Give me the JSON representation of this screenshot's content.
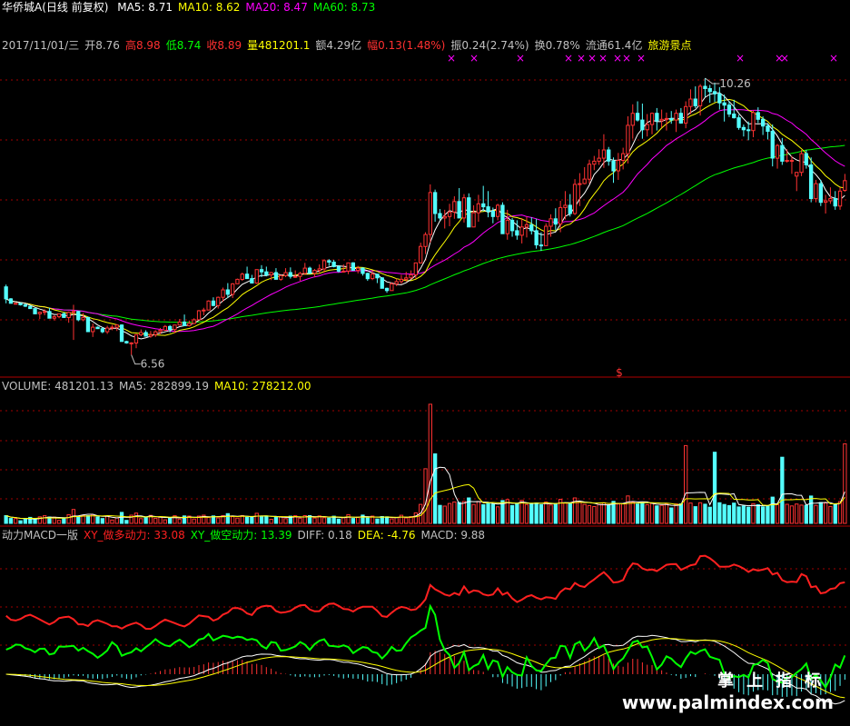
{
  "header": {
    "title": "华侨城A(日线 前复权)",
    "ma": [
      {
        "label": "MA5: 8.71",
        "color": "#ffffff"
      },
      {
        "label": "MA10: 8.62",
        "color": "#ffff00"
      },
      {
        "label": "MA20: 8.47",
        "color": "#ff00ff"
      },
      {
        "label": "MA60: 8.73",
        "color": "#00ff00"
      }
    ]
  },
  "quote": [
    {
      "text": "2017/11/01/三",
      "color": "#c0c0c0"
    },
    {
      "text": "开8.76",
      "color": "#c0c0c0"
    },
    {
      "text": "高8.98",
      "color": "#ff3030"
    },
    {
      "text": "低8.74",
      "color": "#00ff00"
    },
    {
      "text": "收8.89",
      "color": "#ff3030"
    },
    {
      "text": "量481201.1",
      "color": "#ffff00"
    },
    {
      "text": "额4.29亿",
      "color": "#c0c0c0"
    },
    {
      "text": "幅0.13(1.48%)",
      "color": "#ff3030"
    },
    {
      "text": "振0.24(2.74%)",
      "color": "#c0c0c0"
    },
    {
      "text": "换0.78%",
      "color": "#c0c0c0"
    },
    {
      "text": "流通61.4亿",
      "color": "#c0c0c0"
    },
    {
      "text": "旅游景点",
      "color": "#ffff00"
    }
  ],
  "volume_header": [
    {
      "text": "VOLUME: 481201.13",
      "color": "#c0c0c0"
    },
    {
      "text": "MA5: 282899.19",
      "color": "#c0c0c0"
    },
    {
      "text": "MA10: 278212.00",
      "color": "#ffff00"
    }
  ],
  "macd_header": [
    {
      "text": "动力MACD一版",
      "color": "#c0c0c0"
    },
    {
      "text": "XY_做多动力: 33.08",
      "color": "#ff2020"
    },
    {
      "text": "XY_做空动力: 13.39",
      "color": "#00ff00"
    },
    {
      "text": "DIFF: 0.18",
      "color": "#c0c0c0"
    },
    {
      "text": "DEA: -4.76",
      "color": "#ffff00"
    },
    {
      "text": "MACD: 9.88",
      "color": "#c0c0c0"
    }
  ],
  "annotations": {
    "high": "10.26",
    "low": "6.56",
    "marker": "$"
  },
  "watermark": {
    "cn": "掌上指标",
    "url": "www.palmindex.com"
  },
  "colors": {
    "up": "#ff3232",
    "down": "#54ffff",
    "ma5": "#ffffff",
    "ma10": "#ffff00",
    "ma20": "#ff00ff",
    "ma60": "#00ff00",
    "grid": "#a00000",
    "force_long": "#ff2020",
    "force_short": "#00ff00"
  },
  "chart_data": {
    "type": "candlestick",
    "ylim": [
      6.3,
      10.6
    ],
    "ohlc": [
      [
        7.47,
        7.5,
        7.25,
        7.31
      ],
      [
        7.31,
        7.32,
        7.25,
        7.25
      ],
      [
        7.25,
        7.25,
        7.25,
        7.25
      ],
      [
        7.25,
        7.25,
        7.22,
        7.23
      ],
      [
        7.23,
        7.24,
        7.2,
        7.21
      ],
      [
        7.21,
        7.21,
        7.18,
        7.18
      ],
      [
        7.18,
        7.18,
        7.11,
        7.11
      ],
      [
        7.11,
        7.14,
        7.04,
        7.13
      ],
      [
        7.13,
        7.17,
        7.09,
        7.14
      ],
      [
        7.14,
        7.19,
        7.05,
        7.05
      ],
      [
        7.05,
        7.09,
        7.02,
        7.07
      ],
      [
        7.07,
        7.11,
        7.05,
        7.11
      ],
      [
        7.11,
        7.13,
        7.06,
        7.06
      ],
      [
        7.06,
        7.14,
        6.99,
        7.13
      ],
      [
        7.13,
        7.23,
        6.76,
        7.14
      ],
      [
        7.14,
        7.15,
        7.01,
        7.03
      ],
      [
        7.03,
        7.12,
        7.01,
        7.06
      ],
      [
        7.06,
        7.07,
        6.87,
        6.87
      ],
      [
        6.87,
        6.98,
        6.8,
        6.93
      ],
      [
        6.93,
        6.94,
        6.91,
        6.91
      ],
      [
        6.91,
        6.93,
        6.85,
        6.87
      ],
      [
        6.87,
        6.95,
        6.84,
        6.92
      ],
      [
        6.92,
        6.96,
        6.89,
        6.93
      ],
      [
        6.93,
        6.97,
        6.88,
        6.96
      ],
      [
        6.96,
        6.97,
        6.74,
        6.74
      ],
      [
        6.74,
        6.75,
        6.71,
        6.72
      ],
      [
        6.72,
        6.73,
        6.56,
        6.72
      ],
      [
        6.72,
        6.84,
        6.65,
        6.83
      ],
      [
        6.83,
        6.9,
        6.81,
        6.86
      ],
      [
        6.86,
        6.89,
        6.81,
        6.81
      ],
      [
        6.81,
        6.88,
        6.79,
        6.83
      ],
      [
        6.83,
        6.89,
        6.8,
        6.87
      ],
      [
        6.87,
        6.92,
        6.84,
        6.89
      ],
      [
        6.89,
        6.96,
        6.88,
        6.94
      ],
      [
        6.94,
        6.96,
        6.86,
        6.9
      ],
      [
        6.9,
        6.96,
        6.85,
        6.96
      ],
      [
        6.96,
        7.04,
        6.95,
        7.0
      ],
      [
        7.0,
        7.1,
        6.95,
        6.95
      ],
      [
        6.95,
        7.02,
        6.94,
        6.98
      ],
      [
        6.98,
        7.05,
        6.97,
        7.03
      ],
      [
        7.03,
        7.16,
        7.03,
        7.15
      ],
      [
        7.15,
        7.19,
        7.09,
        7.16
      ],
      [
        7.16,
        7.29,
        7.16,
        7.28
      ],
      [
        7.28,
        7.33,
        7.21,
        7.22
      ],
      [
        7.22,
        7.34,
        7.18,
        7.33
      ],
      [
        7.33,
        7.46,
        7.27,
        7.43
      ],
      [
        7.43,
        7.52,
        7.32,
        7.37
      ],
      [
        7.37,
        7.52,
        7.32,
        7.51
      ],
      [
        7.51,
        7.58,
        7.51,
        7.57
      ],
      [
        7.57,
        7.66,
        7.55,
        7.64
      ],
      [
        7.64,
        7.74,
        7.58,
        7.58
      ],
      [
        7.58,
        7.63,
        7.52,
        7.52
      ],
      [
        7.52,
        7.7,
        7.51,
        7.7
      ],
      [
        7.7,
        7.76,
        7.6,
        7.67
      ],
      [
        7.67,
        7.74,
        7.61,
        7.63
      ],
      [
        7.63,
        7.67,
        7.56,
        7.66
      ],
      [
        7.66,
        7.72,
        7.57,
        7.57
      ],
      [
        7.57,
        7.63,
        7.55,
        7.62
      ],
      [
        7.62,
        7.72,
        7.6,
        7.66
      ],
      [
        7.66,
        7.73,
        7.58,
        7.61
      ],
      [
        7.61,
        7.69,
        7.59,
        7.61
      ],
      [
        7.61,
        7.67,
        7.55,
        7.65
      ],
      [
        7.65,
        7.79,
        7.63,
        7.72
      ],
      [
        7.72,
        7.74,
        7.65,
        7.65
      ],
      [
        7.65,
        7.71,
        7.6,
        7.69
      ],
      [
        7.69,
        7.77,
        7.64,
        7.71
      ],
      [
        7.71,
        7.84,
        7.66,
        7.82
      ],
      [
        7.82,
        7.84,
        7.75,
        7.8
      ],
      [
        7.8,
        7.83,
        7.73,
        7.74
      ],
      [
        7.74,
        7.76,
        7.66,
        7.68
      ],
      [
        7.68,
        7.77,
        7.67,
        7.68
      ],
      [
        7.68,
        7.79,
        7.64,
        7.79
      ],
      [
        7.79,
        7.8,
        7.69,
        7.69
      ],
      [
        7.69,
        7.75,
        7.65,
        7.72
      ],
      [
        7.72,
        7.73,
        7.62,
        7.65
      ],
      [
        7.65,
        7.66,
        7.55,
        7.58
      ],
      [
        7.58,
        7.68,
        7.56,
        7.64
      ],
      [
        7.64,
        7.64,
        7.52,
        7.59
      ],
      [
        7.59,
        7.6,
        7.45,
        7.45
      ],
      [
        7.45,
        7.46,
        7.39,
        7.42
      ],
      [
        7.42,
        7.53,
        7.42,
        7.51
      ],
      [
        7.51,
        7.58,
        7.48,
        7.54
      ],
      [
        7.54,
        7.63,
        7.51,
        7.57
      ],
      [
        7.57,
        7.67,
        7.54,
        7.59
      ],
      [
        7.59,
        7.69,
        7.57,
        7.63
      ],
      [
        7.63,
        7.79,
        7.58,
        7.79
      ],
      [
        7.79,
        8.06,
        7.78,
        8.01
      ],
      [
        8.01,
        8.2,
        7.91,
        8.17
      ],
      [
        8.17,
        8.84,
        8.06,
        8.73
      ],
      [
        8.73,
        8.77,
        8.34,
        8.45
      ],
      [
        8.45,
        8.51,
        8.36,
        8.39
      ],
      [
        8.39,
        8.5,
        8.25,
        8.41
      ],
      [
        8.41,
        8.58,
        8.28,
        8.47
      ],
      [
        8.47,
        8.68,
        8.38,
        8.61
      ],
      [
        8.61,
        8.79,
        8.39,
        8.39
      ],
      [
        8.39,
        8.71,
        8.33,
        8.66
      ],
      [
        8.66,
        8.72,
        8.27,
        8.27
      ],
      [
        8.27,
        8.56,
        8.27,
        8.46
      ],
      [
        8.46,
        8.7,
        8.34,
        8.58
      ],
      [
        8.58,
        8.82,
        8.48,
        8.54
      ],
      [
        8.54,
        8.75,
        8.4,
        8.48
      ],
      [
        8.48,
        8.53,
        8.32,
        8.41
      ],
      [
        8.41,
        8.58,
        8.36,
        8.56
      ],
      [
        8.56,
        8.6,
        8.18,
        8.18
      ],
      [
        8.18,
        8.5,
        8.1,
        8.36
      ],
      [
        8.36,
        8.39,
        8.14,
        8.22
      ],
      [
        8.22,
        8.36,
        8.1,
        8.16
      ],
      [
        8.16,
        8.39,
        8.05,
        8.27
      ],
      [
        8.27,
        8.41,
        8.13,
        8.3
      ],
      [
        8.3,
        8.4,
        8.17,
        8.22
      ],
      [
        8.22,
        8.38,
        7.98,
        8.03
      ],
      [
        8.03,
        8.2,
        7.95,
        8.02
      ],
      [
        8.02,
        8.32,
        8.02,
        8.28
      ],
      [
        8.28,
        8.44,
        8.14,
        8.38
      ],
      [
        8.38,
        8.52,
        8.23,
        8.31
      ],
      [
        8.31,
        8.62,
        8.2,
        8.53
      ],
      [
        8.53,
        8.75,
        8.37,
        8.56
      ],
      [
        8.56,
        8.71,
        8.41,
        8.45
      ],
      [
        8.45,
        8.91,
        8.43,
        8.84
      ],
      [
        8.84,
        8.99,
        8.55,
        8.85
      ],
      [
        8.85,
        9.07,
        8.84,
        8.91
      ],
      [
        8.91,
        9.17,
        8.85,
        9.11
      ],
      [
        9.11,
        9.22,
        9.03,
        9.15
      ],
      [
        9.15,
        9.31,
        9.1,
        9.19
      ],
      [
        9.19,
        9.51,
        9.06,
        9.3
      ],
      [
        9.3,
        9.34,
        9.09,
        9.15
      ],
      [
        9.15,
        9.2,
        8.86,
        9.02
      ],
      [
        9.02,
        9.26,
        8.9,
        9.16
      ],
      [
        9.16,
        9.33,
        9.04,
        9.25
      ],
      [
        9.25,
        9.75,
        9.12,
        9.63
      ],
      [
        9.63,
        9.91,
        9.45,
        9.79
      ],
      [
        9.79,
        9.95,
        9.68,
        9.7
      ],
      [
        9.7,
        9.92,
        9.45,
        9.57
      ],
      [
        9.57,
        9.78,
        9.48,
        9.64
      ],
      [
        9.64,
        9.8,
        9.51,
        9.79
      ],
      [
        9.79,
        9.86,
        9.56,
        9.69
      ],
      [
        9.69,
        9.84,
        9.6,
        9.71
      ],
      [
        9.71,
        9.8,
        9.56,
        9.72
      ],
      [
        9.72,
        9.82,
        9.65,
        9.7
      ],
      [
        9.7,
        9.84,
        9.54,
        9.79
      ],
      [
        9.79,
        9.86,
        9.65,
        9.66
      ],
      [
        9.66,
        9.95,
        9.59,
        9.88
      ],
      [
        9.88,
        10.11,
        9.78,
        9.98
      ],
      [
        9.98,
        10.15,
        9.86,
        9.89
      ],
      [
        9.89,
        10.18,
        9.76,
        10.15
      ],
      [
        10.15,
        10.26,
        10.01,
        10.12
      ],
      [
        10.12,
        10.17,
        9.93,
        10.08
      ],
      [
        10.08,
        10.2,
        9.94,
        10.05
      ],
      [
        10.05,
        10.14,
        9.84,
        9.93
      ],
      [
        9.93,
        10.04,
        9.68,
        9.9
      ],
      [
        9.9,
        9.95,
        9.74,
        9.78
      ],
      [
        9.78,
        9.97,
        9.72,
        9.73
      ],
      [
        9.73,
        9.77,
        9.57,
        9.6
      ],
      [
        9.6,
        9.64,
        9.48,
        9.57
      ],
      [
        9.57,
        9.68,
        9.43,
        9.56
      ],
      [
        9.56,
        9.83,
        9.47,
        9.8
      ],
      [
        9.8,
        9.87,
        9.66,
        9.71
      ],
      [
        9.71,
        9.75,
        9.5,
        9.62
      ],
      [
        9.62,
        9.66,
        9.44,
        9.55
      ],
      [
        9.55,
        9.64,
        9.08,
        9.19
      ],
      [
        9.19,
        9.38,
        9.05,
        9.36
      ],
      [
        9.36,
        9.46,
        9.1,
        9.15
      ],
      [
        9.15,
        9.31,
        9.13,
        9.16
      ],
      [
        9.16,
        9.22,
        8.98,
        9.16
      ],
      [
        8.95,
        9.0,
        8.75,
        9.0
      ],
      [
        9.0,
        9.3,
        8.95,
        9.25
      ],
      [
        9.25,
        9.3,
        9.05,
        9.1
      ],
      [
        9.1,
        9.2,
        8.6,
        8.65
      ],
      [
        8.65,
        8.9,
        8.6,
        8.85
      ],
      [
        8.85,
        8.9,
        8.55,
        8.6
      ],
      [
        8.6,
        8.7,
        8.45,
        8.62
      ],
      [
        8.62,
        8.8,
        8.58,
        8.65
      ],
      [
        8.65,
        8.75,
        8.5,
        8.55
      ],
      [
        8.55,
        8.8,
        8.5,
        8.75
      ],
      [
        8.76,
        8.98,
        8.74,
        8.89
      ]
    ],
    "ma": {
      "MA5": 8.71,
      "MA10": 8.62,
      "MA20": 8.47,
      "MA60": 8.73
    },
    "high_label": 10.26,
    "low_label": 6.56
  }
}
